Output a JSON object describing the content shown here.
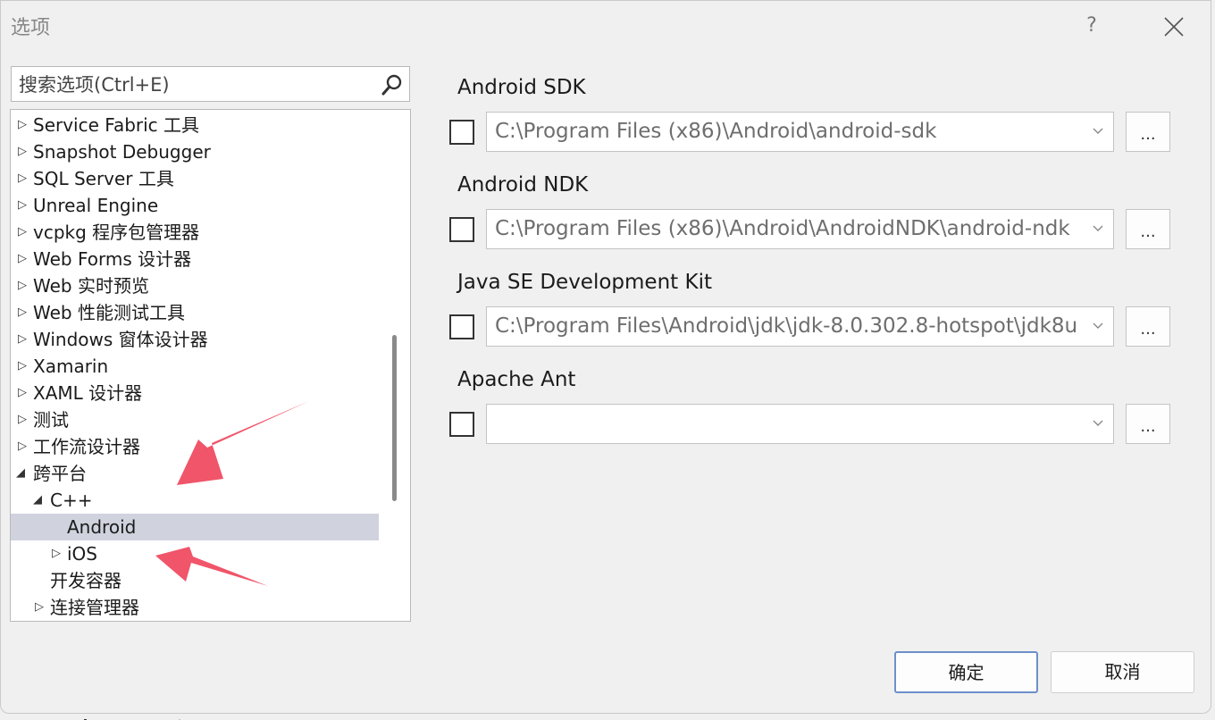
{
  "window": {
    "title": "选项",
    "help_label": "?"
  },
  "search": {
    "placeholder": "搜索选项(Ctrl+E)"
  },
  "tree": {
    "items": [
      {
        "label": "Service Fabric 工具",
        "expander": "▷"
      },
      {
        "label": "Snapshot Debugger",
        "expander": "▷"
      },
      {
        "label": "SQL Server 工具",
        "expander": "▷"
      },
      {
        "label": "Unreal Engine",
        "expander": "▷"
      },
      {
        "label": "vcpkg 程序包管理器",
        "expander": "▷"
      },
      {
        "label": "Web Forms 设计器",
        "expander": "▷"
      },
      {
        "label": "Web 实时预览",
        "expander": "▷"
      },
      {
        "label": "Web 性能测试工具",
        "expander": "▷"
      },
      {
        "label": "Windows 窗体设计器",
        "expander": "▷"
      },
      {
        "label": "Xamarin",
        "expander": "▷"
      },
      {
        "label": "XAML 设计器",
        "expander": "▷"
      },
      {
        "label": "测试",
        "expander": "▷"
      },
      {
        "label": "工作流设计器",
        "expander": "▷"
      },
      {
        "label": "跨平台",
        "expander": "◢"
      },
      {
        "label": "C++",
        "expander": "◢"
      },
      {
        "label": "Android",
        "expander": ""
      },
      {
        "label": "iOS",
        "expander": "▷"
      },
      {
        "label": "开发容器",
        "expander": ""
      },
      {
        "label": "连接管理器",
        "expander": "▷"
      }
    ],
    "selected": "Android"
  },
  "settings": {
    "android_sdk": {
      "label": "Android SDK",
      "value": "C:\\Program Files (x86)\\Android\\android-sdk",
      "checked": false,
      "browse_label": "..."
    },
    "android_ndk": {
      "label": "Android NDK",
      "value": "C:\\Program Files (x86)\\Android\\AndroidNDK\\android-ndk",
      "checked": false,
      "browse_label": "..."
    },
    "java_jdk": {
      "label": "Java SE Development Kit",
      "value": "C:\\Program Files\\Android\\jdk\\jdk-8.0.302.8-hotspot\\jdk8u",
      "checked": false,
      "browse_label": "..."
    },
    "apache_ant": {
      "label": "Apache Ant",
      "value": "",
      "checked": false,
      "browse_label": "..."
    }
  },
  "buttons": {
    "ok": "确定",
    "cancel": "取消"
  },
  "colors": {
    "selection": "#d0d3de",
    "annotation_arrow": "#f0556a",
    "primary_border": "#6e8fc9"
  },
  "icons": [
    "search-icon",
    "close-icon",
    "chevron-down-icon",
    "expand-arrow-icon",
    "collapse-arrow-icon"
  ]
}
